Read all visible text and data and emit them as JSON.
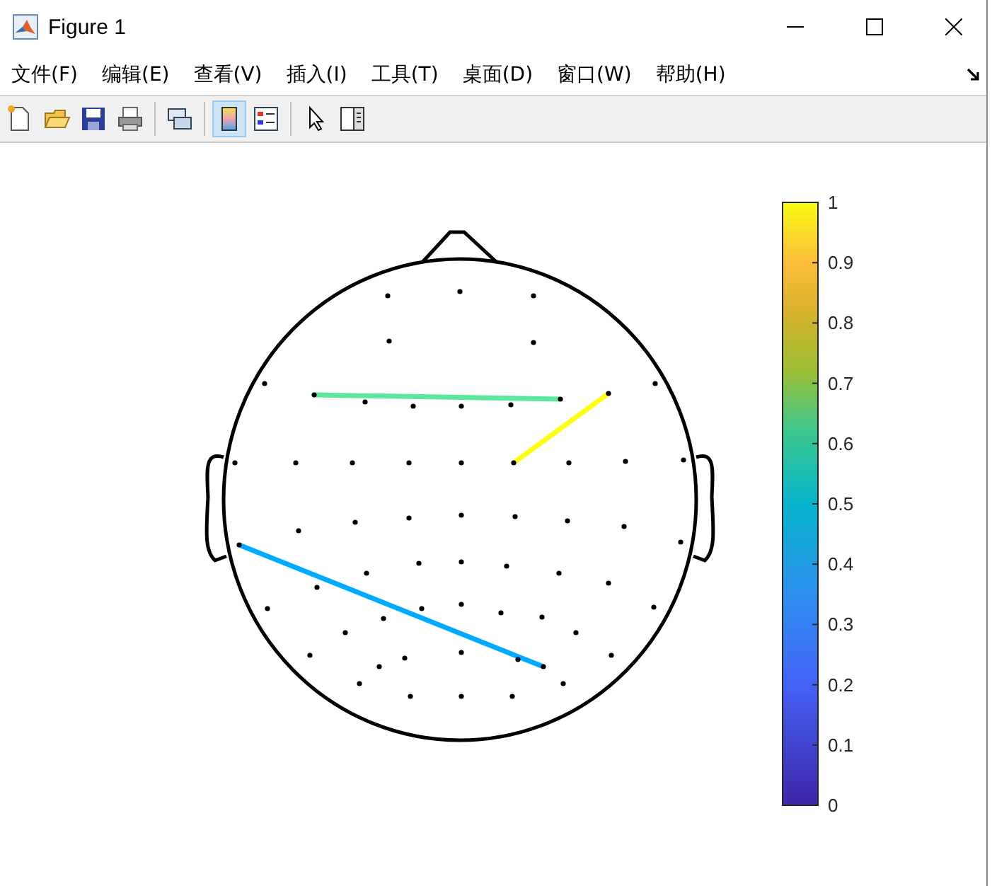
{
  "window": {
    "title": "Figure 1"
  },
  "menu": [
    {
      "label": "文件(F)"
    },
    {
      "label": "编辑(E)"
    },
    {
      "label": "查看(V)"
    },
    {
      "label": "插入(I)"
    },
    {
      "label": "工具(T)"
    },
    {
      "label": "桌面(D)"
    },
    {
      "label": "窗口(W)"
    },
    {
      "label": "帮助(H)"
    }
  ],
  "toolbar": [
    {
      "kind": "new",
      "pressed": false
    },
    {
      "kind": "open",
      "pressed": false
    },
    {
      "kind": "save",
      "pressed": false
    },
    {
      "kind": "print",
      "pressed": false
    },
    {
      "kind": "separator"
    },
    {
      "kind": "link",
      "pressed": false
    },
    {
      "kind": "separator"
    },
    {
      "kind": "colorbar",
      "pressed": true
    },
    {
      "kind": "legend",
      "pressed": false
    },
    {
      "kind": "separator"
    },
    {
      "kind": "pointer",
      "pressed": false
    },
    {
      "kind": "property",
      "pressed": false
    }
  ],
  "connections": [
    {
      "color": "#5ce6a0"
    },
    {
      "color": "#ffff14"
    },
    {
      "color": "#00aaff"
    }
  ],
  "colorbar": {
    "ticks": [
      "1",
      "0.9",
      "0.8",
      "0.7",
      "0.6",
      "0.5",
      "0.4",
      "0.3",
      "0.2",
      "0.1",
      "0"
    ]
  }
}
